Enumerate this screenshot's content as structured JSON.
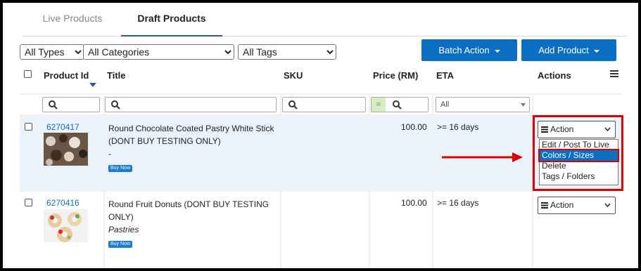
{
  "tabs": {
    "live": "Live Products",
    "draft": "Draft Products"
  },
  "filters": {
    "types": "All Types",
    "categories": "All Categories",
    "tags": "All Tags"
  },
  "buttons": {
    "batch_action": "Batch Action",
    "add_product": "Add Product"
  },
  "columns": {
    "product_id": "Product Id",
    "title": "Title",
    "sku": "SKU",
    "price": "Price (RM)",
    "eta": "ETA",
    "actions": "Actions"
  },
  "search": {
    "price_op": "=",
    "eta_value": "All"
  },
  "rows": [
    {
      "id": "6270417",
      "title_line1": "Round Chocolate Coated Pastry White Stick",
      "title_line2": "(DONT BUY TESTING ONLY)",
      "category": "-",
      "badge": "Buy Now",
      "price": "100.00",
      "eta": ">= 16 days",
      "action": "Action"
    },
    {
      "id": "6270416",
      "title_line1": "Round Fruit Donuts (DONT BUY TESTING",
      "title_line2": "ONLY)",
      "category": "Pastries",
      "badge": "Buy Now",
      "price": "100.00",
      "eta": ">= 16 days",
      "action": "Action"
    }
  ],
  "action_menu": [
    "Edit / Post To Live",
    "Colors / Sizes",
    "Delete",
    "Tags / Folders"
  ],
  "colors": {
    "accent": "#0a6fc2",
    "highlight": "#dd0000",
    "link": "#1a6bbf"
  }
}
